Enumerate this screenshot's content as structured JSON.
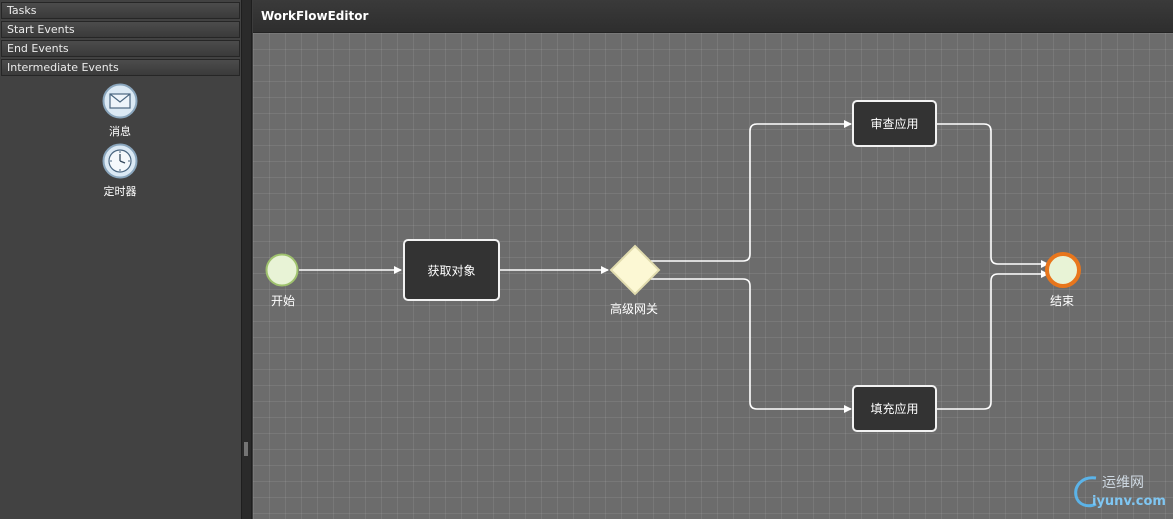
{
  "sidebar": {
    "sections": [
      "Tasks",
      "Start Events",
      "End Events",
      "Intermediate Events"
    ],
    "palette": [
      {
        "label": "消息",
        "icon": "envelope-icon"
      },
      {
        "label": "定时器",
        "icon": "clock-icon"
      }
    ]
  },
  "header": {
    "title": "WorkFlowEditor"
  },
  "diagram": {
    "start_event": "开始",
    "task_get_object": "获取对象",
    "gateway": "高级网关",
    "task_review": "审查应用",
    "task_fill": "填充应用",
    "end_event": "结束"
  },
  "watermark": {
    "line1": "运维网",
    "line2": "iyunv.com"
  },
  "colors": {
    "start_fill": "#e8f3d6",
    "start_stroke": "#9fc26e",
    "end_stroke": "#e8761c",
    "gateway_fill": "#fcf8d4"
  }
}
